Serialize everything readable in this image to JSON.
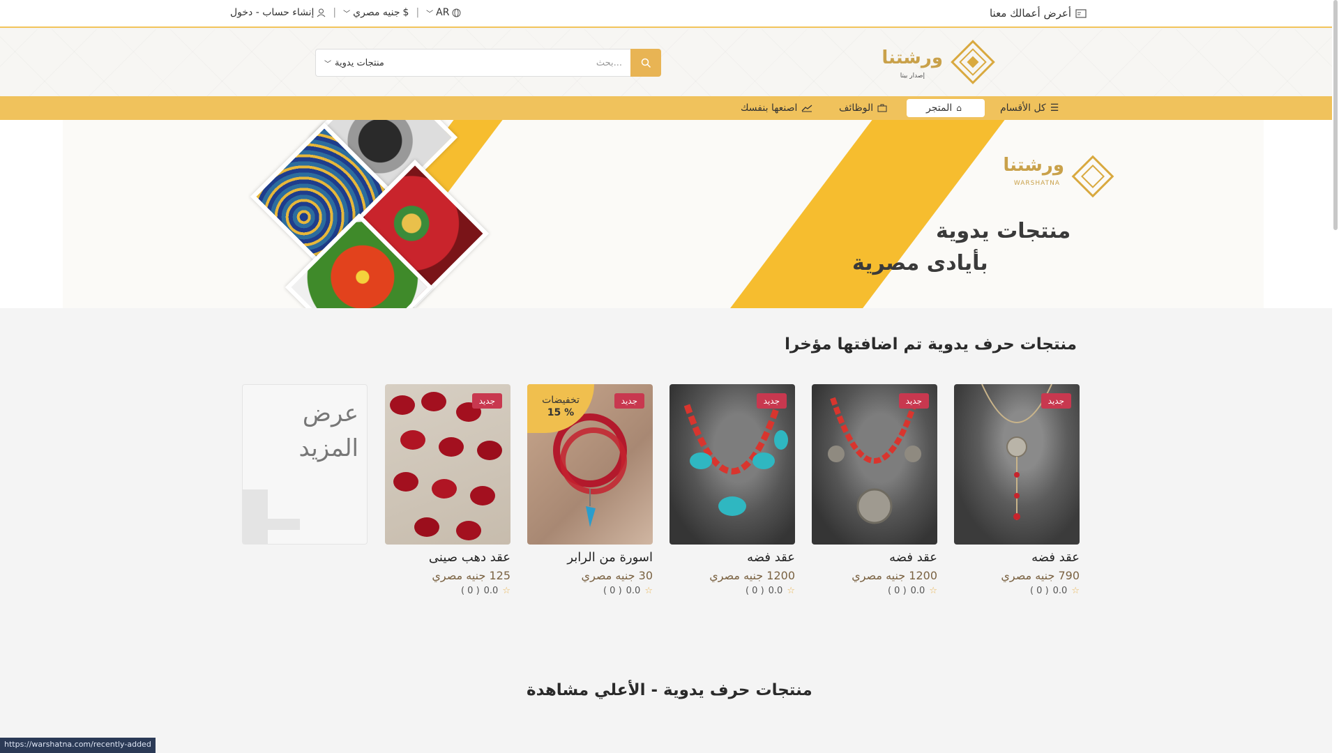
{
  "topbar": {
    "sell_label": "أعرض أعمالك معنا",
    "account_label": "إنشاء حساب - دخول",
    "currency_label": "جنيه مصري",
    "language_label": "AR"
  },
  "search": {
    "placeholder": "بحث...",
    "category": "منتجات يدوية"
  },
  "nav": {
    "all_categories": "كل الأقسام",
    "store": "المتجر",
    "jobs": "الوظائف",
    "diy": "اصنعها بنفسك"
  },
  "banner": {
    "line1": "منتجات يدوية",
    "line2": "بأيادى مصرية",
    "brand_ar": "ورشتنا",
    "brand_en": "WARSHATNA"
  },
  "logo": {
    "name": "ورشتنا",
    "tagline": "إصدار بيتا"
  },
  "colors": {
    "accent": "#f0c25c",
    "badge": "#c8384f",
    "price": "#7a6242"
  },
  "sections": {
    "recent_title": "منتجات حرف يدوية تم اضافتها مؤخرا",
    "most_viewed_title": "منتجات حرف يدوية - الأعلي مشاهدة",
    "view_more": "عرض المزيد"
  },
  "products": [
    {
      "name": "عقد فضه",
      "price": "790 جنيه مصري",
      "badge": "جديد",
      "rating": "0.0",
      "count": "( 0 )",
      "discount": ""
    },
    {
      "name": "عقد فضه",
      "price": "1200 جنيه مصري",
      "badge": "جديد",
      "rating": "0.0",
      "count": "( 0 )",
      "discount": ""
    },
    {
      "name": "عقد فضه",
      "price": "1200 جنيه مصري",
      "badge": "جديد",
      "rating": "0.0",
      "count": "( 0 )",
      "discount": ""
    },
    {
      "name": "اسورة من الرابر",
      "price": "30 جنيه مصري",
      "badge": "جديد",
      "rating": "0.0",
      "count": "( 0 )",
      "discount": "تخفيضات",
      "discount_value": "15 %"
    },
    {
      "name": "عقد دهب صينى",
      "price": "125 جنيه مصري",
      "badge": "جديد",
      "rating": "0.0",
      "count": "( 0 )",
      "discount": ""
    }
  ],
  "statusbar": "https://warshatna.com/recently-added"
}
